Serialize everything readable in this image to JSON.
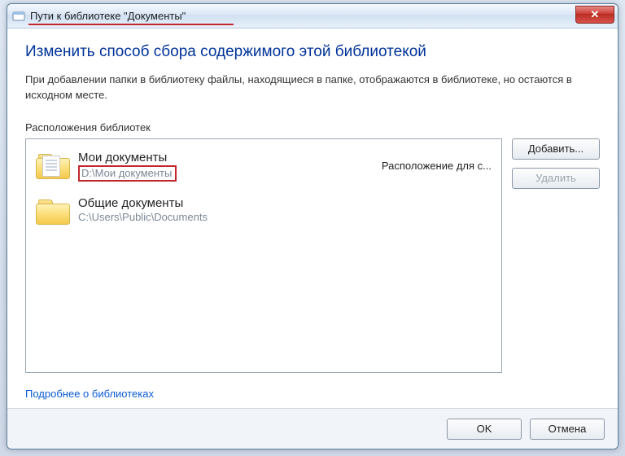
{
  "title": "Пути к библиотеке \"Документы\"",
  "close_glyph": "✕",
  "heading": "Изменить способ сбора содержимого этой библиотекой",
  "description": "При добавлении папки в библиотеку файлы, находящиеся в папке, отображаются в библиотеке, но остаются в исходном месте.",
  "list_label": "Расположения библиотек",
  "locations": [
    {
      "name": "Мои документы",
      "path": "D:\\Мои документы",
      "status": "Расположение для с..."
    },
    {
      "name": "Общие документы",
      "path": "C:\\Users\\Public\\Documents",
      "status": ""
    }
  ],
  "buttons": {
    "add": "Добавить...",
    "remove": "Удалить",
    "ok": "OK",
    "cancel": "Отмена"
  },
  "more_link": "Подробнее о библиотеках"
}
